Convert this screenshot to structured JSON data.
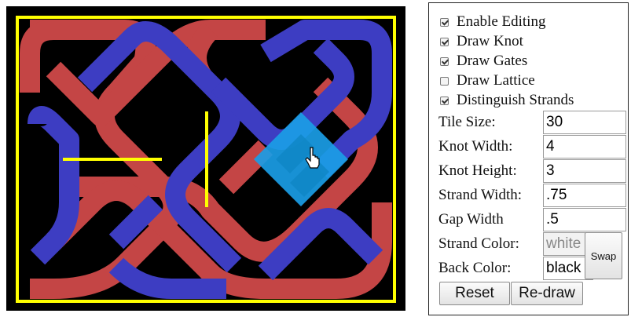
{
  "settings": {
    "checkboxes": [
      {
        "label": "Enable Editing",
        "checked": true
      },
      {
        "label": "Draw Knot",
        "checked": true
      },
      {
        "label": "Draw Gates",
        "checked": true
      },
      {
        "label": "Draw Lattice",
        "checked": false
      },
      {
        "label": "Distinguish Strands",
        "checked": true
      }
    ],
    "fields": [
      {
        "label": "Tile Size:",
        "value": "30"
      },
      {
        "label": "Knot Width:",
        "value": "4"
      },
      {
        "label": "Knot Height:",
        "value": "3"
      },
      {
        "label": "Strand Width:",
        "value": ".75"
      },
      {
        "label": "Gap Width",
        "value": ".5"
      },
      {
        "label": "Strand Color:",
        "value": "white",
        "disabled": true
      },
      {
        "label": "Back Color:",
        "value": "black"
      }
    ],
    "buttons": {
      "swap": "Swap",
      "reset": "Reset",
      "redraw": "Re-draw"
    }
  },
  "colors": {
    "background": "#000000",
    "frame": "#ffff00",
    "strand_red": "#c44545",
    "strand_blue": "#3d3dc2",
    "highlight": "#1a9de6"
  },
  "icons": {
    "cursor": "hand-pointer-icon"
  }
}
